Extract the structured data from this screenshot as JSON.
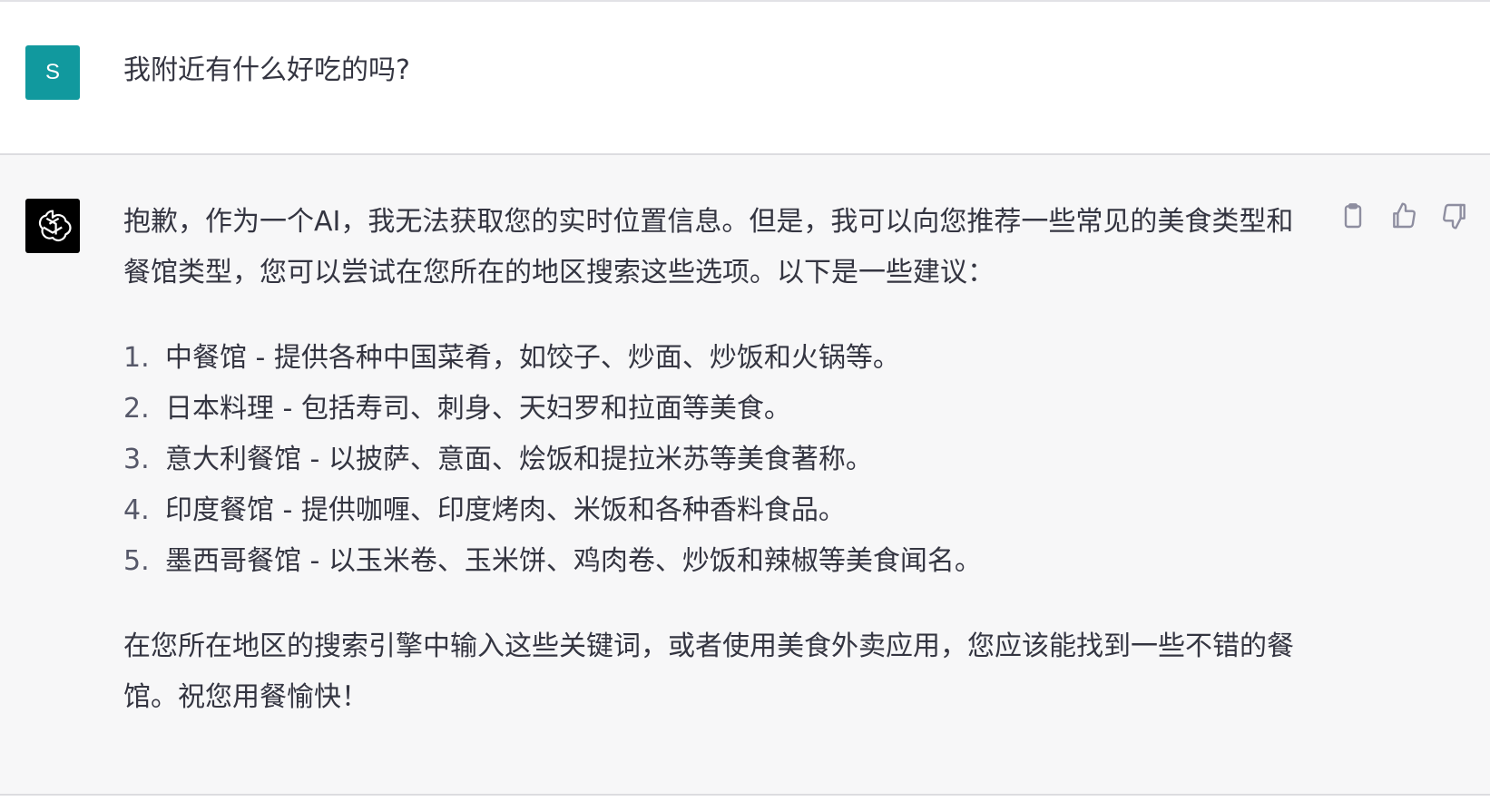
{
  "user_message": {
    "avatar_letter": "S",
    "avatar_color": "#11999e",
    "text": "我附近有什么好吃的吗?"
  },
  "assistant_message": {
    "avatar_icon": "openai-logo-icon",
    "intro": "抱歉，作为一个AI，我无法获取您的实时位置信息。但是，我可以向您推荐一些常见的美食类型和餐馆类型，您可以尝试在您所在的地区搜索这些选项。以下是一些建议：",
    "list": [
      {
        "num": "1.",
        "text": "中餐馆 - 提供各种中国菜肴，如饺子、炒面、炒饭和火锅等。"
      },
      {
        "num": "2.",
        "text": "日本料理 - 包括寿司、刺身、天妇罗和拉面等美食。"
      },
      {
        "num": "3.",
        "text": "意大利餐馆 - 以披萨、意面、烩饭和提拉米苏等美食著称。"
      },
      {
        "num": "4.",
        "text": "印度餐馆 - 提供咖喱、印度烤肉、米饭和各种香料食品。"
      },
      {
        "num": "5.",
        "text": "墨西哥餐馆 - 以玉米卷、玉米饼、鸡肉卷、炒饭和辣椒等美食闻名。"
      }
    ],
    "closing": "在您所在地区的搜索引擎中输入这些关键词，或者使用美食外卖应用，您应该能找到一些不错的餐馆。祝您用餐愉快！"
  },
  "actions": [
    {
      "icon": "clipboard-icon"
    },
    {
      "icon": "thumbs-up-icon"
    },
    {
      "icon": "thumbs-down-icon"
    }
  ],
  "colors": {
    "user_bg": "#ffffff",
    "assistant_bg": "#f7f7f8",
    "text": "#343541",
    "icon": "#8e8ea0"
  }
}
